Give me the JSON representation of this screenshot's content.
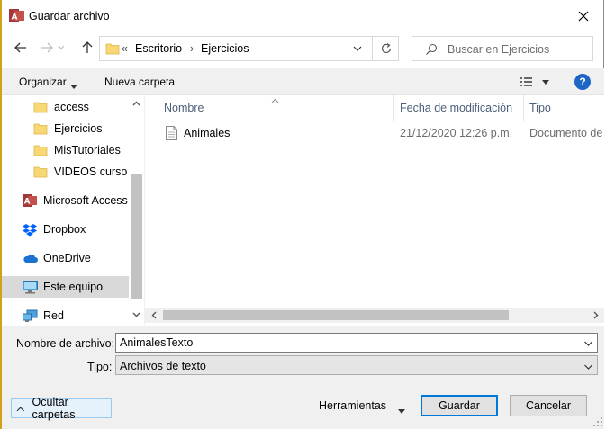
{
  "window": {
    "title": "Guardar archivo",
    "app_icon": "access-app-icon",
    "close_icon": "close-icon"
  },
  "navigation": {
    "path_prefix": "«",
    "path": [
      "Escritorio",
      "Ejercicios"
    ],
    "path_separator": "›",
    "search_placeholder": "Buscar en Ejercicios"
  },
  "toolbar": {
    "organize_label": "Organizar",
    "new_folder_label": "Nueva carpeta",
    "help_label": "?"
  },
  "sidebar": {
    "items": [
      {
        "label": "access",
        "icon": "folder-icon"
      },
      {
        "label": "Ejercicios",
        "icon": "folder-icon"
      },
      {
        "label": "MisTutoriales",
        "icon": "folder-icon"
      },
      {
        "label": "VIDEOS curso Ac",
        "icon": "folder-icon"
      },
      {
        "label": "Microsoft Access",
        "icon": "access-icon"
      },
      {
        "label": "Dropbox",
        "icon": "dropbox-icon"
      },
      {
        "label": "OneDrive",
        "icon": "onedrive-icon"
      },
      {
        "label": "Este equipo",
        "icon": "computer-icon",
        "selected": true
      },
      {
        "label": "Red",
        "icon": "network-icon"
      }
    ]
  },
  "files": {
    "columns": [
      "Nombre",
      "Fecha de modificación",
      "Tipo"
    ],
    "rows": [
      {
        "name": "Animales",
        "modified": "21/12/2020 12:26 p.m.",
        "type": "Documento de t"
      }
    ]
  },
  "form": {
    "filename_label": "Nombre de archivo:",
    "filename_value": "AnimalesTexto",
    "type_label": "Tipo:",
    "type_value": "Archivos de texto",
    "hide_folders_label": "Ocultar carpetas",
    "tools_label": "Herramientas",
    "save_label": "Guardar",
    "cancel_label": "Cancelar"
  },
  "colors": {
    "accent": "#0078d7",
    "folder": "#f8d775",
    "selection": "#d9d9d9",
    "help": "#1e66c6"
  }
}
